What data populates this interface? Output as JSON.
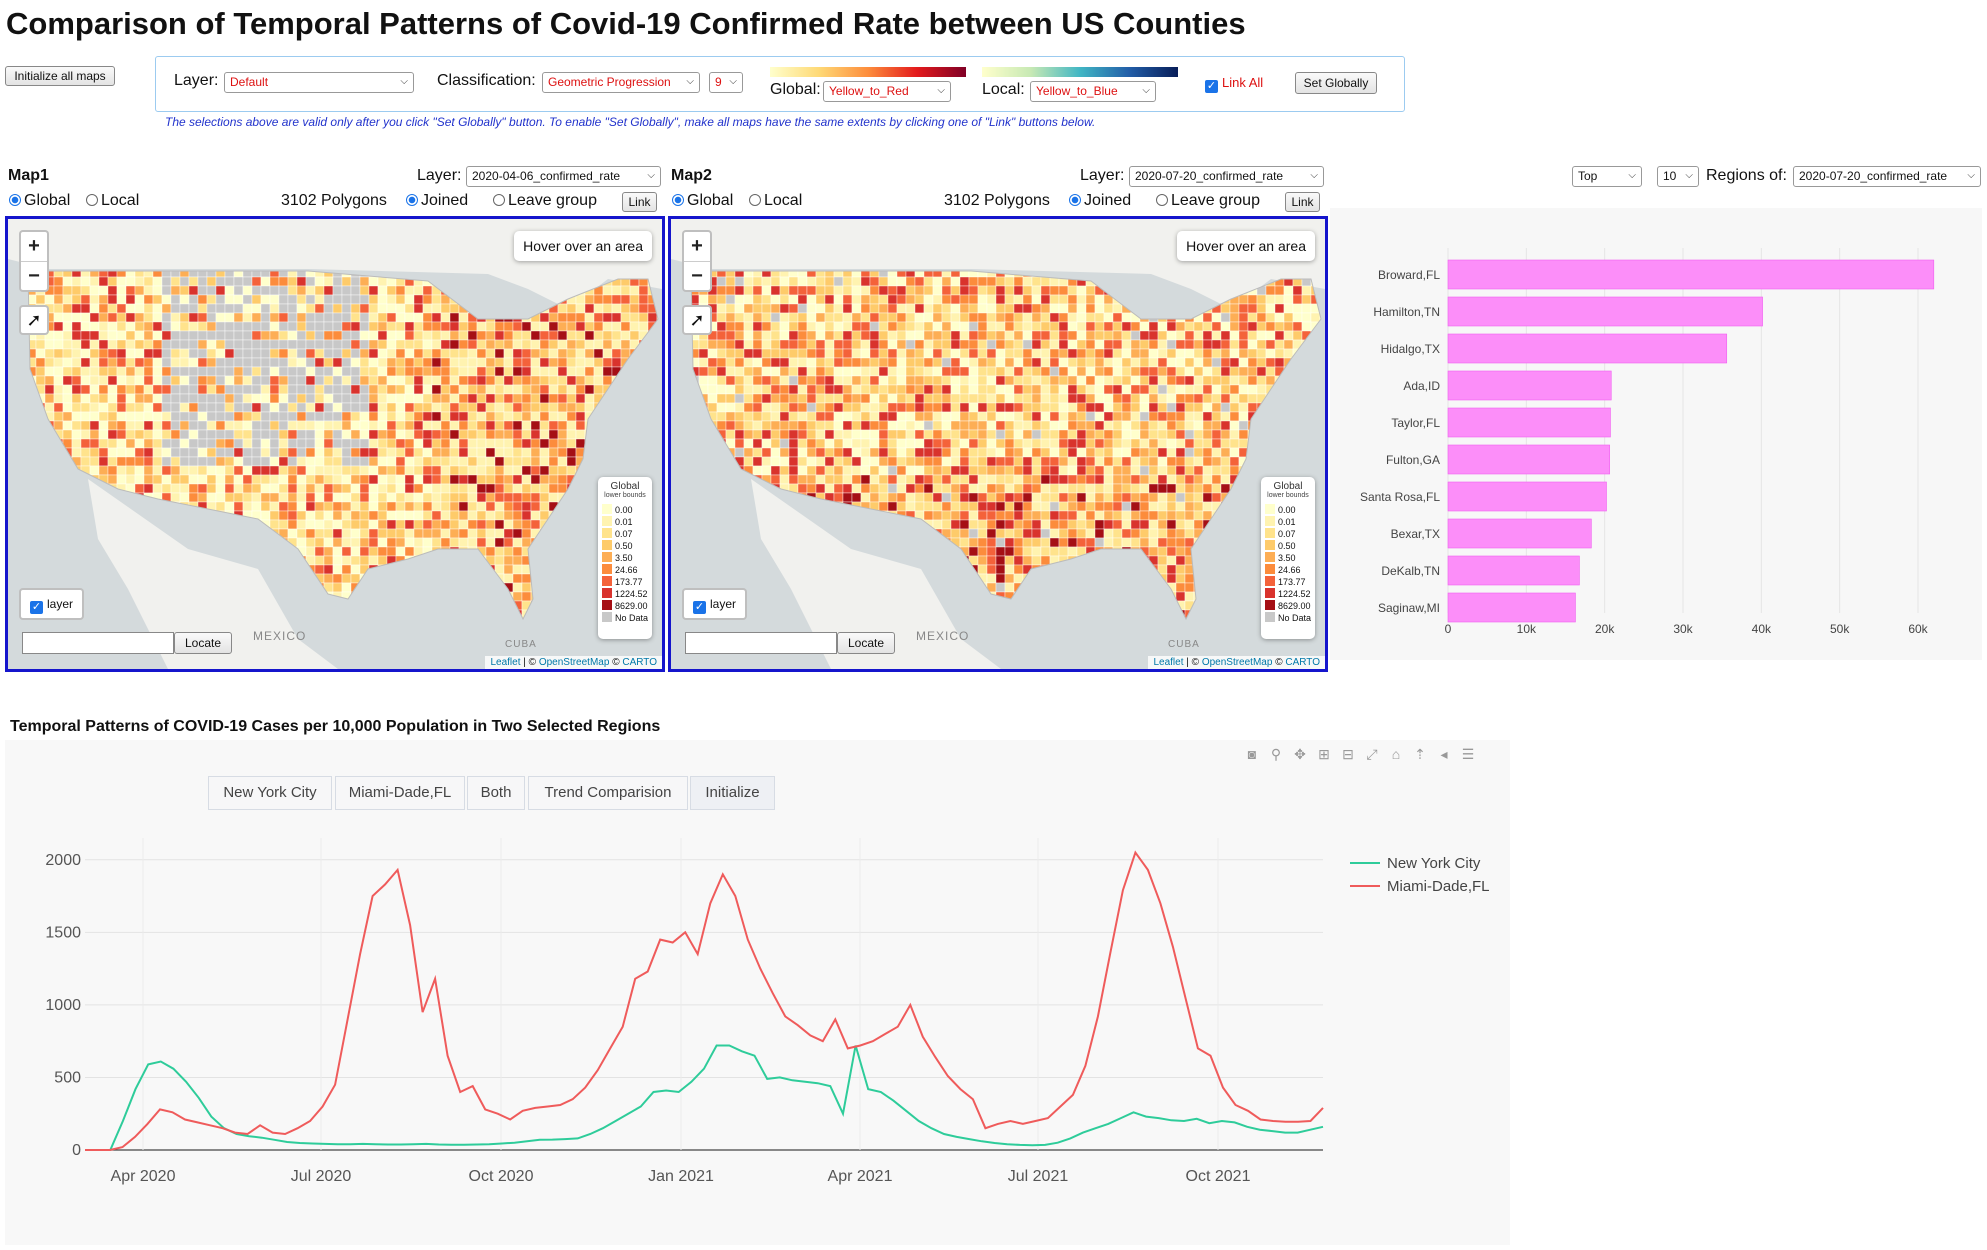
{
  "title": "Comparison of Temporal Patterns of Covid-19 Confirmed Rate between US Counties",
  "init_button": "Initialize all maps",
  "controls": {
    "layer_label": "Layer:",
    "layer_value": "Default",
    "classification_label": "Classification:",
    "classification_value": "Geometric Progression",
    "classes_value": "9",
    "global_label": "Global:",
    "global_value": "Yellow_to_Red",
    "local_label": "Local:",
    "local_value": "Yellow_to_Blue",
    "link_all_label": "Link All",
    "link_all_checked": true,
    "set_globally": "Set Globally",
    "note": "The selections above are valid only after you click \"Set Globally\" button. To enable \"Set Globally\", make all maps have the same extents by clicking one of \"Link\" buttons below."
  },
  "maps": [
    {
      "title": "Map1",
      "layer_label": "Layer:",
      "layer_value": "2020-04-06_confirmed_rate",
      "global_label": "Global",
      "local_label": "Local",
      "polygons": "3102 Polygons",
      "joined_label": "Joined",
      "leave_label": "Leave group",
      "link_button": "Link",
      "hover_text": "Hover over an area",
      "layer_toggle": "layer",
      "locate_button": "Locate",
      "mexico": "MEXICO",
      "cuba": "CUBA",
      "attribution": [
        "Leaflet",
        " | © ",
        "OpenStreetMap",
        " © ",
        "CARTO"
      ]
    },
    {
      "title": "Map2",
      "layer_label": "Layer:",
      "layer_value": "2020-07-20_confirmed_rate",
      "global_label": "Global",
      "local_label": "Local",
      "polygons": "3102 Polygons",
      "joined_label": "Joined",
      "leave_label": "Leave group",
      "link_button": "Link",
      "hover_text": "Hover over an area",
      "layer_toggle": "layer",
      "locate_button": "Locate",
      "mexico": "MEXICO",
      "cuba": "CUBA",
      "attribution": [
        "Leaflet",
        " | © ",
        "OpenStreetMap",
        " © ",
        "CARTO"
      ]
    }
  ],
  "legend": {
    "title": "Global",
    "subtitle": "lower bounds",
    "entries": [
      {
        "label": "0.00",
        "color": "#ffffcc"
      },
      {
        "label": "0.01",
        "color": "#fff3b0"
      },
      {
        "label": "0.07",
        "color": "#ffe38c"
      },
      {
        "label": "0.50",
        "color": "#fecb6a"
      },
      {
        "label": "3.50",
        "color": "#fdae55"
      },
      {
        "label": "24.66",
        "color": "#fc8c3c"
      },
      {
        "label": "173.77",
        "color": "#f4623a"
      },
      {
        "label": "1224.52",
        "color": "#d9332d"
      },
      {
        "label": "8629.00",
        "color": "#a50f15"
      },
      {
        "label": "No Data",
        "color": "#c8c8c8"
      }
    ]
  },
  "ranking": {
    "top_value": "Top",
    "count_value": "10",
    "regions_label": "Regions of:",
    "regions_value": "2020-07-20_confirmed_rate"
  },
  "chart_data": [
    {
      "type": "bar",
      "orientation": "horizontal",
      "categories": [
        "Broward,FL",
        "Hamilton,TN",
        "Hidalgo,TX",
        "Ada,ID",
        "Taylor,FL",
        "Fulton,GA",
        "Santa Rosa,FL",
        "Bexar,TX",
        "DeKalb,TN",
        "Saginaw,MI"
      ],
      "values": [
        61000,
        39500,
        35000,
        20500,
        20400,
        20300,
        19900,
        18000,
        16500,
        16000
      ],
      "xlim": [
        0,
        65000
      ],
      "xticks": [
        "0",
        "10k",
        "20k",
        "30k",
        "40k",
        "50k",
        "60k"
      ],
      "color": "#fc8ef9"
    },
    {
      "type": "line",
      "title": "Temporal Patterns of COVID-19 Cases per 10,000 Population in Two Selected Regions",
      "buttons": [
        "New York City",
        "Miami-Dade,FL",
        "Both",
        "Trend Comparision",
        "Initialize"
      ],
      "x_ticks": [
        "Apr 2020",
        "Jul 2020",
        "Oct 2020",
        "Jan 2021",
        "Apr 2021",
        "Jul 2021",
        "Oct 2021"
      ],
      "y_ticks": [
        0,
        500,
        1000,
        1500,
        2000
      ],
      "ylim": [
        0,
        2150
      ],
      "xlim": [
        0,
        88
      ],
      "series": [
        {
          "name": "New York City",
          "color": "#2ecc9a",
          "values": [
            0,
            0,
            0,
            200,
            420,
            590,
            610,
            560,
            470,
            360,
            230,
            150,
            110,
            95,
            85,
            70,
            55,
            48,
            45,
            42,
            40,
            40,
            42,
            40,
            38,
            38,
            40,
            42,
            38,
            36,
            36,
            38,
            40,
            45,
            50,
            60,
            70,
            72,
            75,
            80,
            110,
            150,
            200,
            250,
            300,
            400,
            410,
            400,
            470,
            560,
            720,
            720,
            680,
            650,
            490,
            500,
            480,
            470,
            460,
            440,
            250,
            720,
            420,
            400,
            340,
            270,
            200,
            150,
            110,
            90,
            75,
            60,
            48,
            40,
            35,
            33,
            35,
            50,
            80,
            120,
            150,
            180,
            220,
            260,
            230,
            220,
            205,
            200,
            215,
            185,
            200,
            190,
            160,
            140,
            130,
            120,
            120,
            140,
            160
          ]
        },
        {
          "name": "Miami-Dade,FL",
          "color": "#ef5b5b",
          "values": [
            0,
            0,
            0,
            20,
            90,
            180,
            280,
            260,
            210,
            190,
            170,
            150,
            120,
            110,
            170,
            120,
            110,
            150,
            200,
            300,
            450,
            900,
            1350,
            1750,
            1830,
            1930,
            1550,
            950,
            1180,
            650,
            400,
            440,
            280,
            250,
            210,
            270,
            290,
            300,
            310,
            350,
            430,
            550,
            700,
            850,
            1180,
            1230,
            1450,
            1430,
            1500,
            1350,
            1700,
            1900,
            1750,
            1450,
            1250,
            1080,
            920,
            860,
            790,
            750,
            900,
            700,
            720,
            750,
            800,
            850,
            1000,
            780,
            640,
            510,
            420,
            350,
            150,
            180,
            200,
            180,
            200,
            220,
            300,
            380,
            580,
            920,
            1360,
            1790,
            2050,
            1930,
            1700,
            1400,
            1050,
            700,
            650,
            430,
            310,
            270,
            210,
            200,
            195,
            195,
            200,
            290
          ]
        }
      ]
    }
  ]
}
